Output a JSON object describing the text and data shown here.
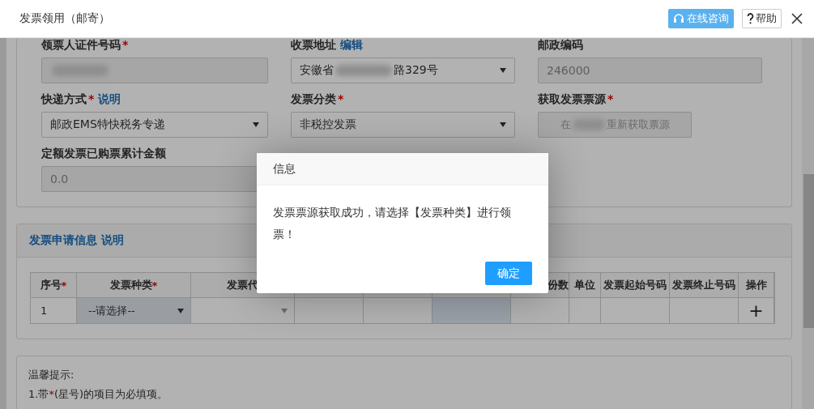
{
  "window": {
    "title": "发票领用（邮寄）",
    "buttons": [
      {
        "kind": "consult",
        "label": "在线咨询"
      },
      {
        "kind": "help",
        "label": "帮助"
      }
    ]
  },
  "form": {
    "fields": [
      {
        "kind": "input",
        "label": "领票人证件号码",
        "required": true,
        "disabled": true,
        "redacted": true
      },
      {
        "kind": "select",
        "label": "收票地址",
        "link": "编辑",
        "required": false,
        "value": "安徽省",
        "value_end": "路329号",
        "redacted": true
      },
      {
        "kind": "input",
        "label": "邮政编码",
        "required": false,
        "disabled": true,
        "value": "246000"
      },
      {
        "kind": "select",
        "label": "快递方式",
        "required": true,
        "link": "说明",
        "value": "邮政EMS特快税务专递"
      },
      {
        "kind": "select",
        "label": "发票分类",
        "required": true,
        "value": "非税控发票"
      },
      {
        "kind": "button",
        "label": "获取发票票源",
        "required": true,
        "value": "在",
        "value_end": "重新获取票源",
        "redacted": true
      },
      {
        "kind": "input",
        "label": "定额发票已购票累计金额",
        "required": false,
        "disabled": true,
        "value": "0.0"
      }
    ]
  },
  "application": {
    "title": "发票申请信息",
    "link": "说明",
    "columns": [
      {
        "label": "序号",
        "required": true
      },
      {
        "label": "发票种类",
        "required": true
      },
      {
        "label": "发票代",
        "required": false
      },
      {
        "required": false
      },
      {
        "required": false
      },
      {
        "required": false
      },
      {
        "label": "份数",
        "required": false
      },
      {
        "label": "单位",
        "required": false
      },
      {
        "label": "发票起始号码",
        "required": false
      },
      {
        "label": "发票终止号码",
        "required": false
      },
      {
        "label": "操作",
        "required": false
      }
    ],
    "rows": [
      {
        "cells": [
          {
            "kind": "text",
            "value": "1"
          },
          {
            "kind": "select",
            "value": "--请选择--"
          },
          {
            "kind": "select_empty"
          },
          {
            "kind": "empty"
          },
          {
            "kind": "empty"
          },
          {
            "kind": "input"
          },
          {
            "kind": "empty"
          },
          {
            "kind": "empty"
          },
          {
            "kind": "empty"
          },
          {
            "kind": "empty"
          },
          {
            "kind": "add",
            "value": "+"
          }
        ]
      }
    ]
  },
  "tips": {
    "title": "温馨提示:",
    "items": [
      {
        "prefix": "1.带",
        "star": "*",
        "suffix": "(星号)的项目为必填项。"
      }
    ]
  },
  "modal": {
    "title": "信息",
    "message": "发票票源获取成功，请选择【发票种类】进行领票！",
    "button": "确定"
  }
}
